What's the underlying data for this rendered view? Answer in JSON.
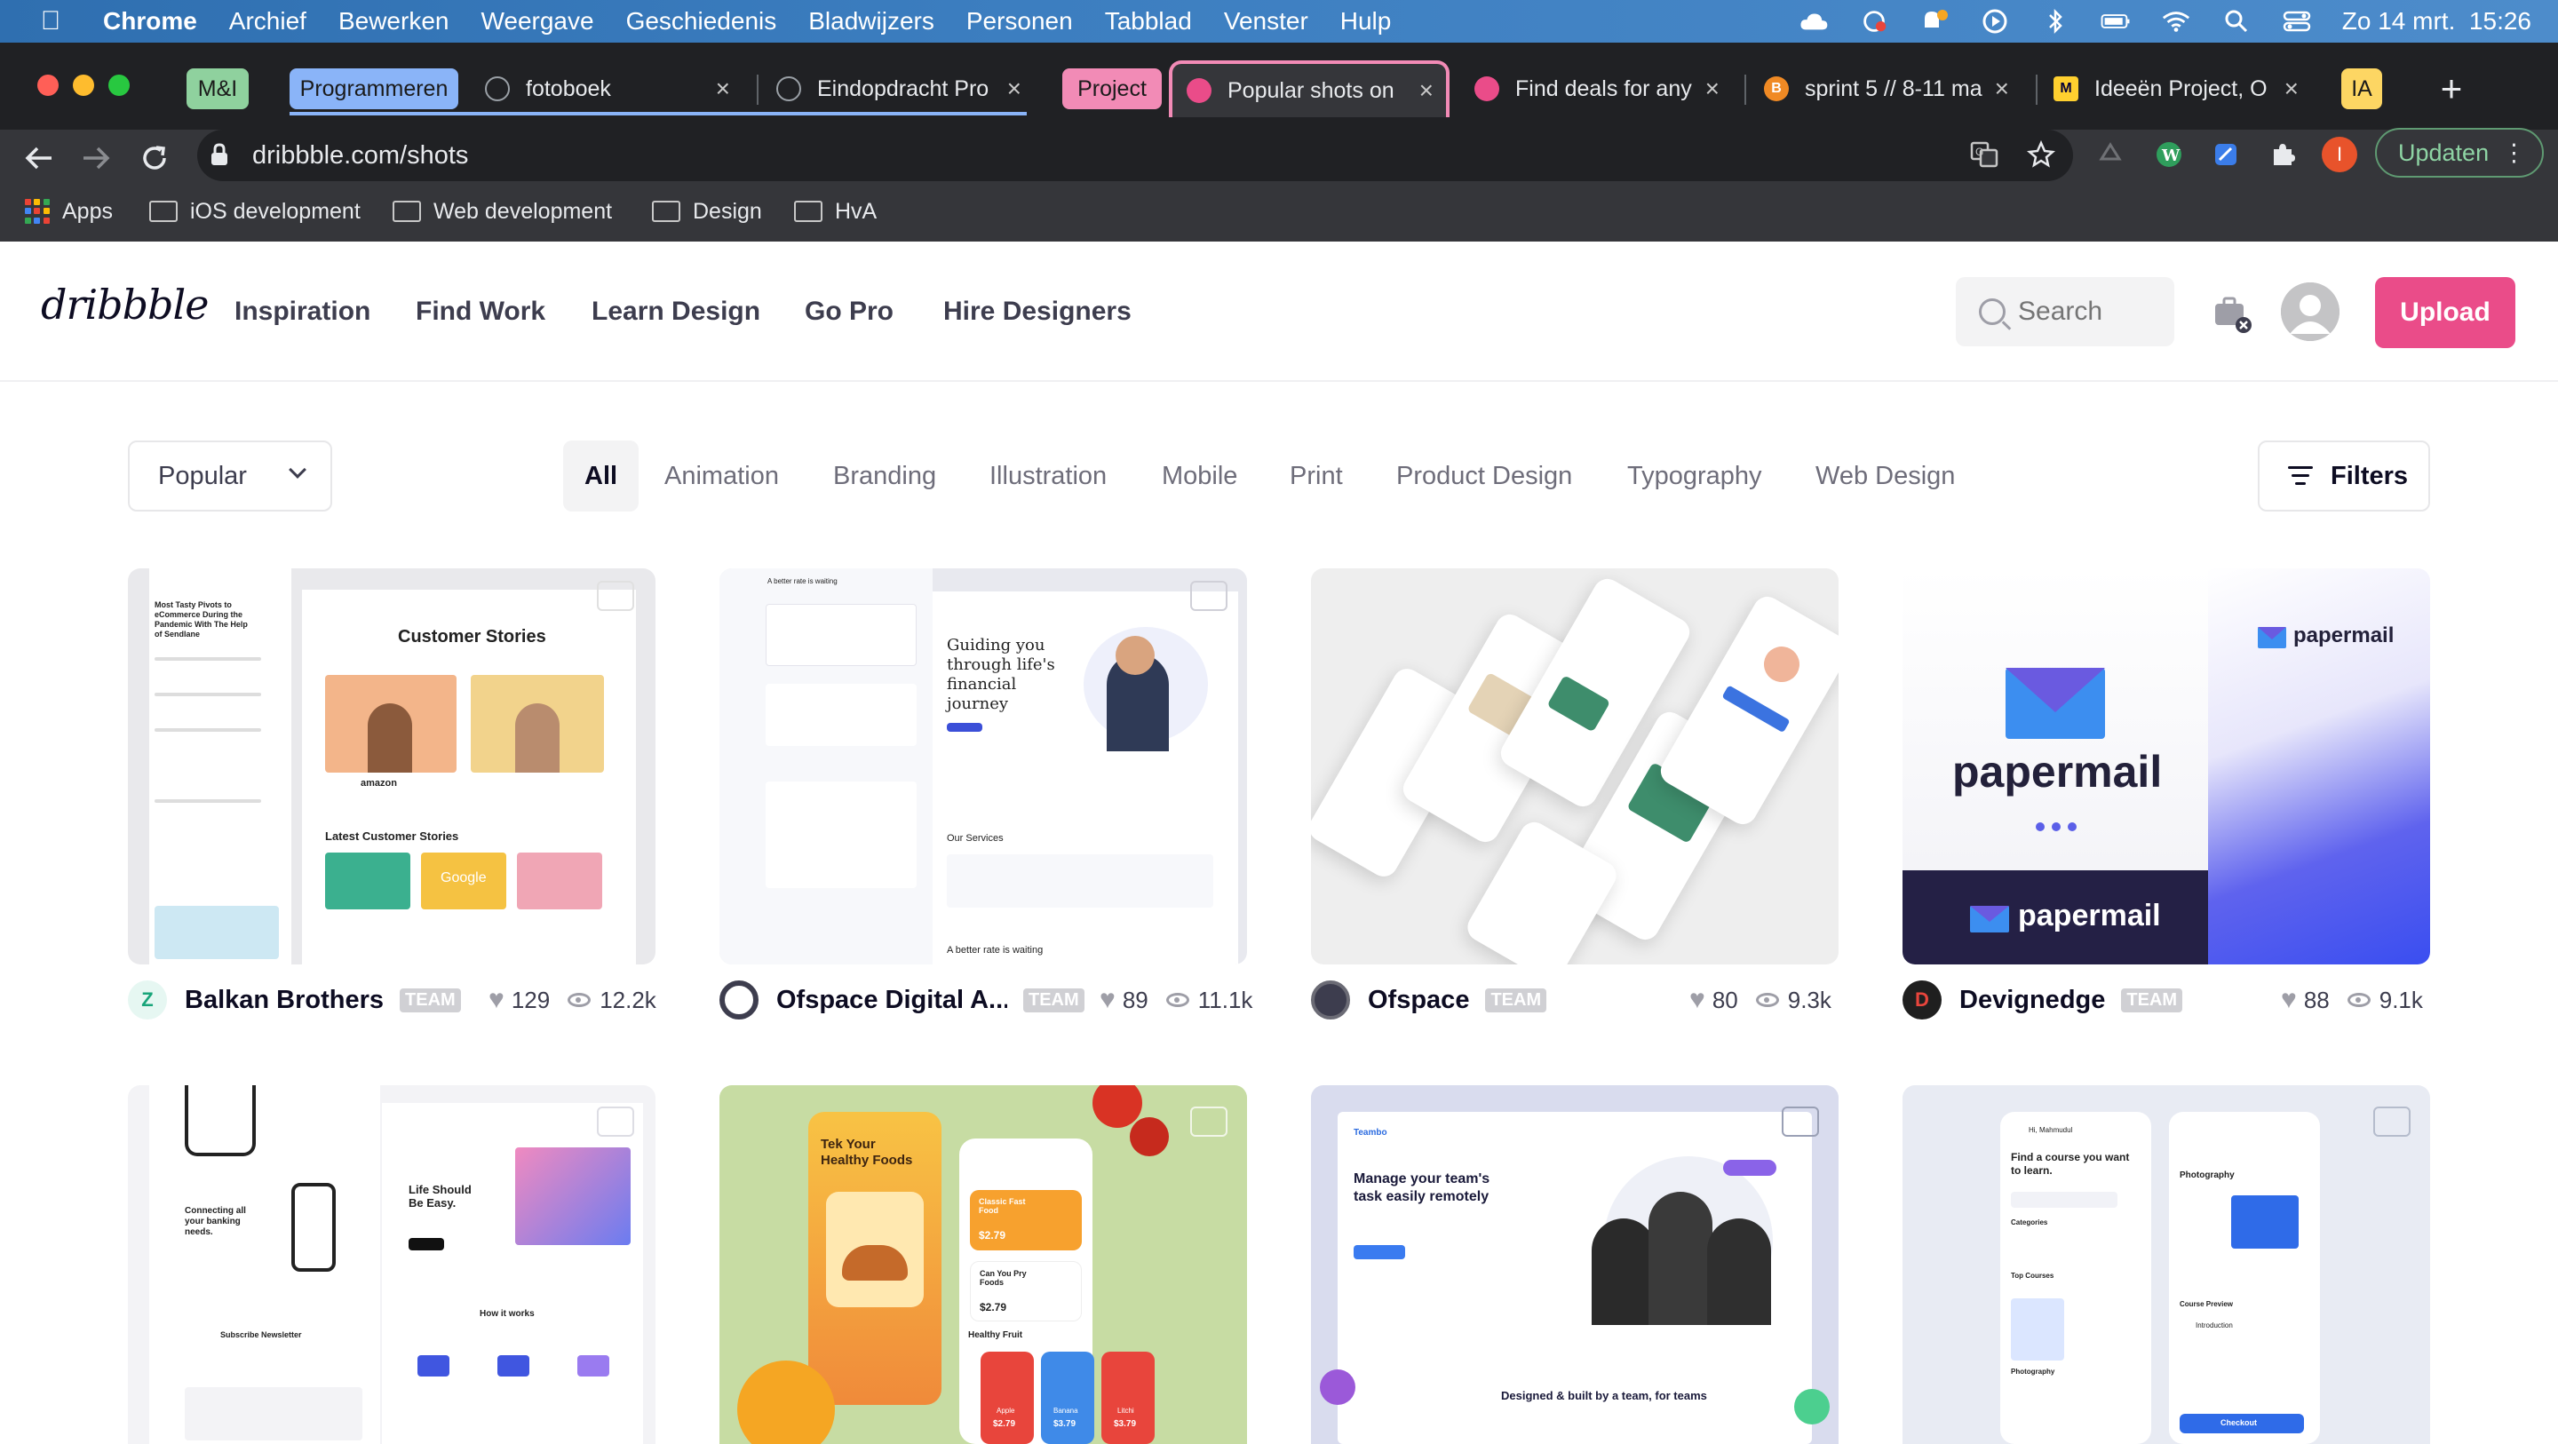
{
  "menubar": {
    "app": "Chrome",
    "items": [
      "Archief",
      "Bewerken",
      "Weergave",
      "Geschiedenis",
      "Bladwijzers",
      "Personen",
      "Tabblad",
      "Venster",
      "Hulp"
    ],
    "clock": "Zo 14 mrt.  15:26"
  },
  "tabs": {
    "groups": [
      {
        "label": "M&I",
        "color": "#8fd19e"
      },
      {
        "label": "Programmeren",
        "color": "#8ab4f8"
      },
      {
        "label": "Project",
        "color": "#f28bb6"
      },
      {
        "label": "IA",
        "color": "#fdd663"
      }
    ],
    "items": [
      {
        "title": "fotoboek"
      },
      {
        "title": "Eindopdracht Pro"
      },
      {
        "title": "Popular shots on"
      },
      {
        "title": "Find deals for any"
      },
      {
        "title": "sprint 5 // 8-11 ma"
      },
      {
        "title": "Ideeën Project, O"
      }
    ],
    "close_glyph": "×",
    "new_tab_glyph": "+"
  },
  "toolbar": {
    "url": "dribbble.com/shots",
    "update_label": "Updaten",
    "profile_initial": "I"
  },
  "bookmarks": {
    "apps_label": "Apps",
    "folders": [
      "iOS development",
      "Web development",
      "Design",
      "HvA"
    ]
  },
  "site": {
    "logo": "dribbble",
    "nav": [
      "Inspiration",
      "Find Work",
      "Learn Design",
      "Go Pro",
      "Hire Designers"
    ],
    "search_placeholder": "Search",
    "upload_label": "Upload"
  },
  "filters": {
    "sort": "Popular",
    "categories": [
      "All",
      "Animation",
      "Branding",
      "Illustration",
      "Mobile",
      "Print",
      "Product Design",
      "Typography",
      "Web Design"
    ],
    "active_category": "All",
    "filters_label": "Filters"
  },
  "team_badge": "TEAM",
  "shots": [
    {
      "author": "Balkan Brothers",
      "likes": "129",
      "views": "12.2k",
      "preview": {
        "heading": "Customer Stories",
        "subheading": "Latest Customer Stories",
        "side_text": "Most Tasty Pivots to eCommerce During the Pandemic With The Help of Sendlane",
        "brand": "amazon",
        "brand2": "Google"
      }
    },
    {
      "author": "Ofspace Digital A...",
      "likes": "89",
      "views": "11.1k",
      "preview": {
        "heading": "Guiding you through life's financial journey",
        "section": "Our Services",
        "footer": "A better rate is waiting",
        "left_heading": "A better rate is waiting"
      }
    },
    {
      "author": "Ofspace",
      "likes": "80",
      "views": "9.3k",
      "preview": {}
    },
    {
      "author": "Devignedge",
      "likes": "88",
      "views": "9.1k",
      "preview": {
        "brand": "papermail"
      }
    },
    {
      "author": "",
      "likes": "",
      "views": "",
      "preview": {
        "heading": "Life Should Be Easy.",
        "side": "Connecting all your banking needs.",
        "section": "How it works",
        "footer": "Subscribe Newsletter"
      }
    },
    {
      "author": "",
      "likes": "",
      "views": "",
      "preview": {
        "heading": "Tek Your Healthy Foods",
        "card1": "Classic Fast Food",
        "price1": "$2.79",
        "card2": "Can You Pry Foods",
        "price2": "$2.79",
        "section": "Healthy Fruit",
        "fruit1": "Apple",
        "fp1": "$2.79",
        "fruit2": "Banana",
        "fp2": "$3.79",
        "fruit3": "Litchi",
        "fp3": "$3.79"
      }
    },
    {
      "author": "",
      "likes": "",
      "views": "",
      "preview": {
        "brand": "Teambo",
        "heading": "Manage your team's task easily remotely",
        "footer": "Designed & built by a team, for teams"
      }
    },
    {
      "author": "",
      "likes": "",
      "views": "",
      "preview": {
        "greeting": "Hi, Mahmudul",
        "heading": "Find a course you want to learn.",
        "cat": "Categories",
        "top": "Top Courses",
        "course": "Photography",
        "preview_label": "Course Preview",
        "intro": "Introduction",
        "checkout": "Checkout"
      }
    }
  ]
}
